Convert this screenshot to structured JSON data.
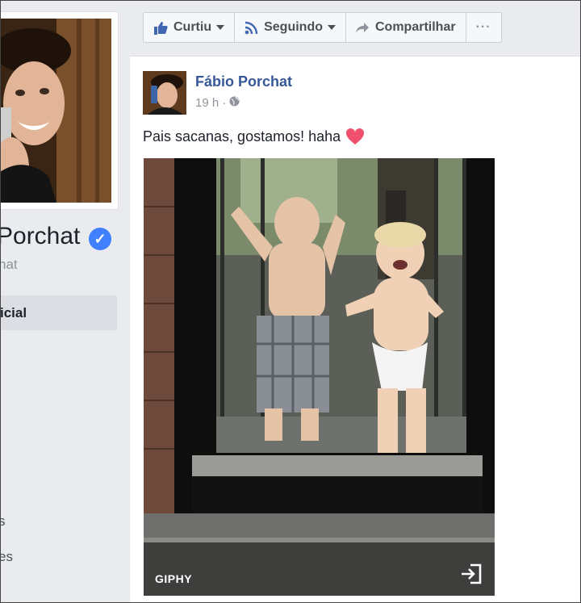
{
  "profile": {
    "name": "Porchat",
    "handle": "hat",
    "nav": {
      "active": "icial",
      "items": [
        "s",
        "es"
      ]
    }
  },
  "action_bar": {
    "like_label": "Curtiu",
    "follow_label": "Seguindo",
    "share_label": "Compartilhar",
    "more_label": "···"
  },
  "post": {
    "author": "Fábio Porchat",
    "time": "19 h",
    "separator": "·",
    "text": "Pais sacanas, gostamos! haha",
    "media": {
      "provider_label": "GIPHY"
    }
  },
  "colors": {
    "link": "#365899",
    "verified": "#4080ff",
    "heart": "#f0506e"
  }
}
